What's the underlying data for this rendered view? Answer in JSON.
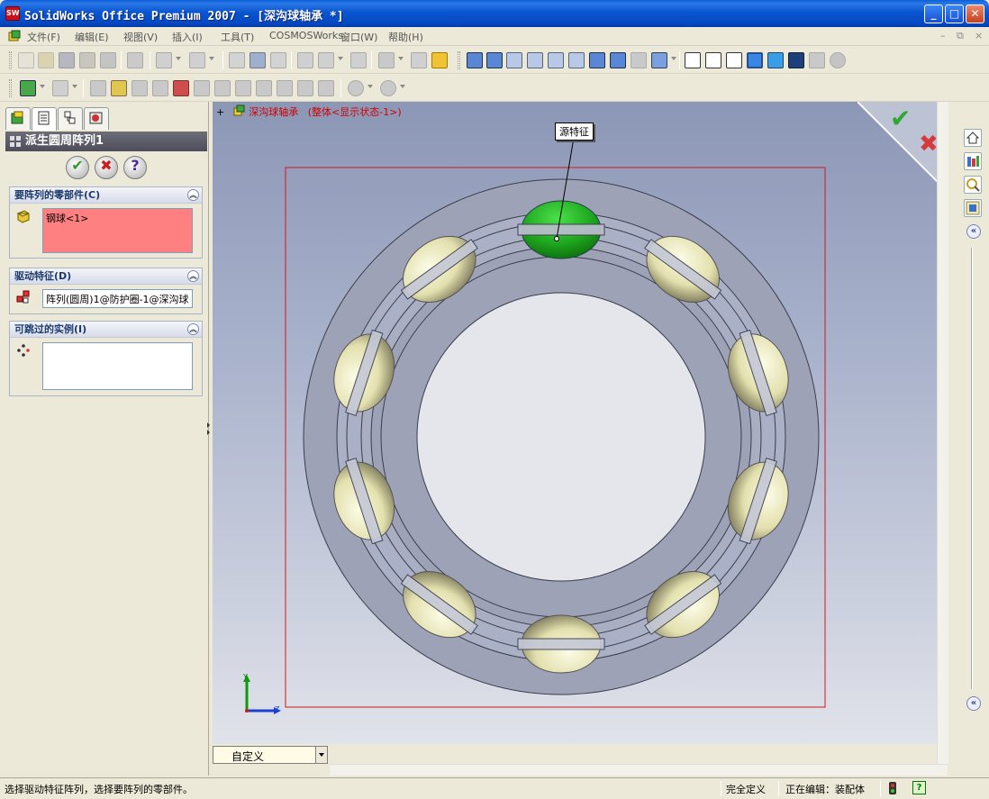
{
  "window": {
    "title": "SolidWorks Office Premium 2007 - [深沟球轴承 *]",
    "app_icon": "SW",
    "min": "_",
    "max": "□",
    "close": "✕"
  },
  "menu": {
    "items": [
      "文件(F)",
      "编辑(E)",
      "视图(V)",
      "插入(I)",
      "工具(T)",
      "COSMOSWorks",
      "窗口(W)",
      "帮助(H)"
    ],
    "mdi_min": "–",
    "mdi_restore": "⧉",
    "mdi_close": "×"
  },
  "property_manager": {
    "header": "派生圆周阵列1",
    "ok": "✔",
    "cancel": "✖",
    "help": "?",
    "groups": {
      "components": {
        "label": "要阵列的零部件(C)",
        "value": "钢球<1>"
      },
      "driving": {
        "label": "驱动特征(D)",
        "value": "阵列(圆周)1@防护圈-1@深沟球"
      },
      "skip": {
        "label": "可跳过的实例(I)",
        "value": ""
      }
    }
  },
  "viewport": {
    "tree_plus": "+",
    "tree_name": "深沟球轴承",
    "tree_config": "(整体<显示状态-1>)",
    "callout": "源特征",
    "confirm_ok": "✔",
    "confirm_cancel": "✖",
    "axis_y": "Y",
    "axis_z": "Z",
    "view_dropdown": "自定义"
  },
  "status": {
    "message": "选择驱动特征阵列，选择要阵列的零部件。",
    "definition": "完全定义",
    "editing": "正在编辑：装配体",
    "help": "?"
  },
  "colors": {
    "titlebar": "#0b55d0",
    "selected_field": "#ff8080",
    "ball": "#e8e6b8",
    "source_ball": "#1ea51e",
    "ring": "#9ea2b6"
  }
}
